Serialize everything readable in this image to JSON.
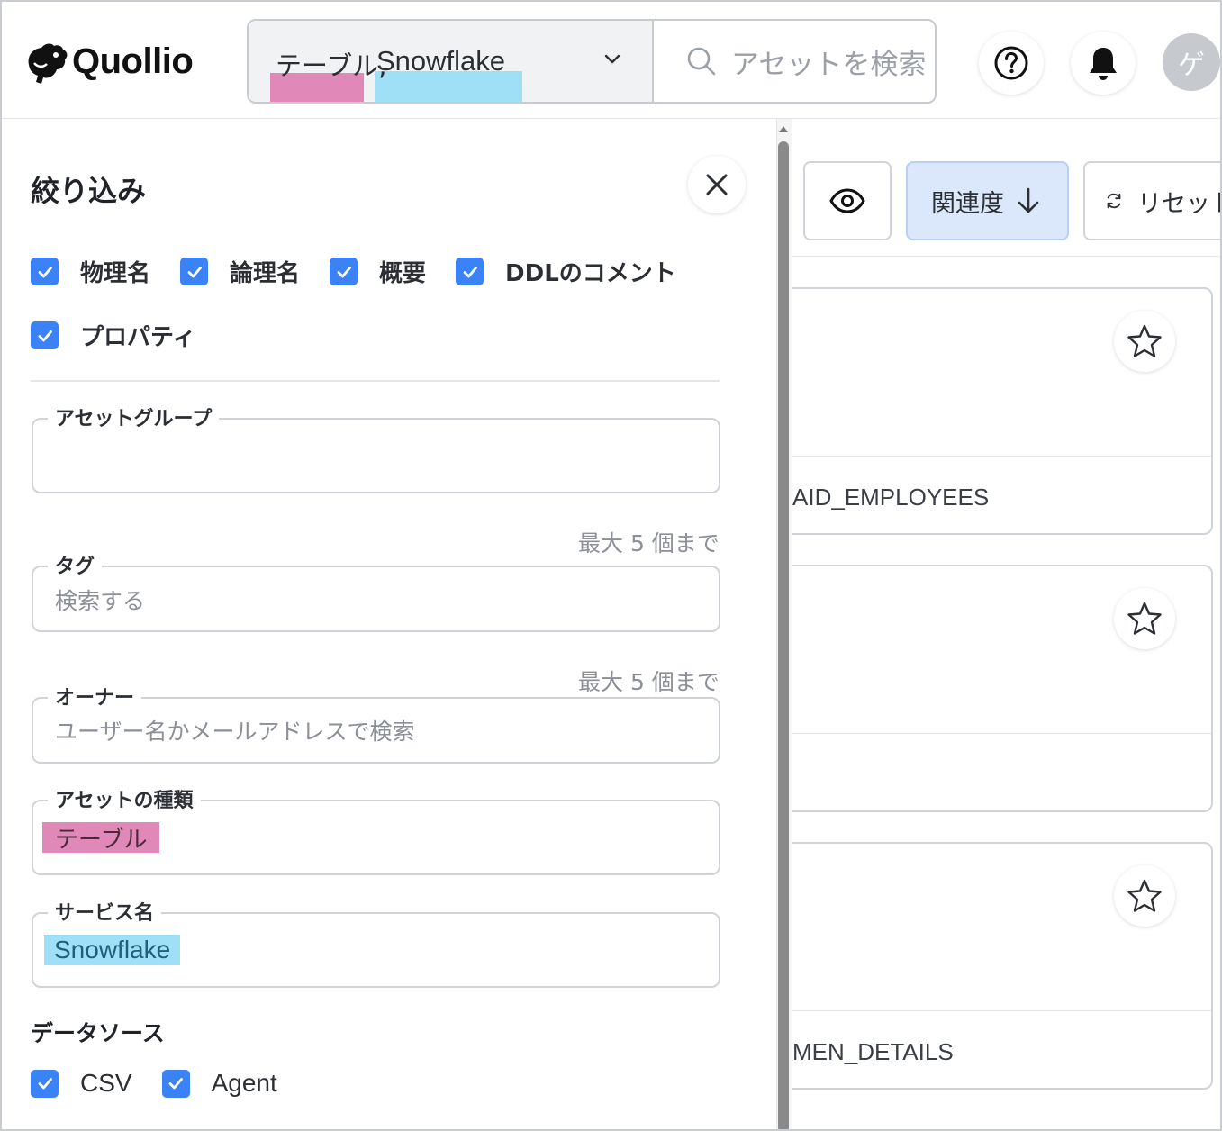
{
  "header": {
    "logo_text": "Quollio",
    "filter_chips": [
      "テーブル,",
      "Snowflake"
    ],
    "highlight_colors": {
      "asset_type": "#e088b8",
      "service": "#9fe0f7"
    },
    "search_placeholder": "アセットを検索",
    "help_icon": "question-circle-icon",
    "notification_icon": "bell-icon",
    "avatar_initial": "ゲ"
  },
  "filter_panel": {
    "title": "絞り込み",
    "search_targets": [
      {
        "label": "物理名",
        "checked": true
      },
      {
        "label": "論理名",
        "checked": true
      },
      {
        "label": "概要",
        "checked": true
      },
      {
        "label": "DDLのコメント",
        "checked": true
      },
      {
        "label": "プロパティ",
        "checked": true
      }
    ],
    "asset_group": {
      "label": "アセットグループ",
      "value": ""
    },
    "tag": {
      "label": "タグ",
      "placeholder": "検索する",
      "limit": "最大 5 個まで"
    },
    "owner": {
      "label": "オーナー",
      "placeholder": "ユーザー名かメールアドレスで検索",
      "limit": "最大 5 個まで"
    },
    "asset_type": {
      "label": "アセットの種類",
      "value": "テーブル"
    },
    "service_name": {
      "label": "サービス名",
      "value": "Snowflake"
    },
    "data_source": {
      "title": "データソース",
      "options": [
        {
          "label": "CSV",
          "checked": true
        },
        {
          "label": "Agent",
          "checked": true
        }
      ]
    }
  },
  "toolbar": {
    "visibility_icon": "eye-icon",
    "sort_label": "関連度",
    "sort_icon": "arrow-down-icon",
    "reset_label": "リセット",
    "reset_icon": "refresh-icon",
    "active_color": "#dbe8fc"
  },
  "results": [
    {
      "name": "AID_EMPLOYEES",
      "favorite": false
    },
    {
      "name": "",
      "favorite": false
    },
    {
      "name": "MEN_DETAILS",
      "favorite": false
    }
  ],
  "colors": {
    "accent": "#3b82f6",
    "border": "#d0d4d8",
    "text": "#1f2328"
  }
}
